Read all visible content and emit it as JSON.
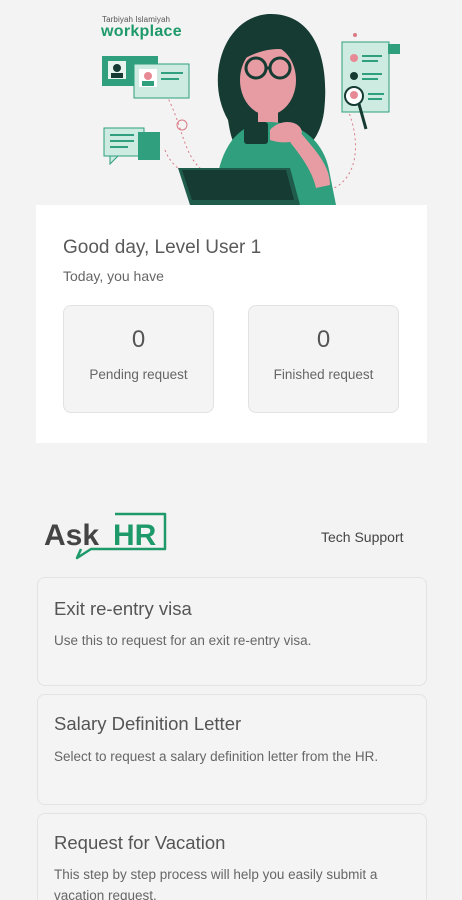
{
  "header": {
    "brand_small": "Tarbiyah Islamiyah",
    "brand_big": "workplace"
  },
  "summary": {
    "greeting": "Good day, Level User 1",
    "subtitle": "Today, you have",
    "pending": {
      "count": "0",
      "label": "Pending request"
    },
    "finished": {
      "count": "0",
      "label": "Finished request"
    }
  },
  "askhr": {
    "logo_ask": "Ask",
    "logo_hr": "HR",
    "tech_support_label": "Tech Support"
  },
  "requests": [
    {
      "title": "Exit re-entry visa",
      "description": "Use this to request for an exit re-entry visa."
    },
    {
      "title": "Salary Definition Letter",
      "description": "Select to request a salary definition letter from the HR."
    },
    {
      "title": "Request for Vacation",
      "description": "This step by step process will help you easily submit a vacation request."
    }
  ],
  "colors": {
    "brand_green": "#1e9a6a",
    "illustration_teal": "#2f9f7e",
    "hair": "#153b33",
    "background": "#f3f3f3"
  }
}
